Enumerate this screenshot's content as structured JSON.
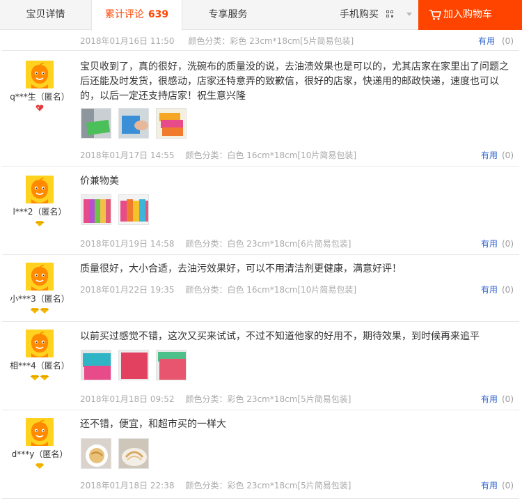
{
  "tabs": {
    "detail": "宝贝详情",
    "reviews": "累计评论",
    "reviews_count": "639",
    "service": "专享服务",
    "mobile": "手机购买",
    "cart": "加入购物车"
  },
  "accent_color": "#ff4400",
  "link_color": "#3366cc",
  "useful_label": "有用",
  "first_row": {
    "date": "2018年01月16日 11:50",
    "sku": "颜色分类：彩色  23cm*18cm[5片简易包装]",
    "useful_count": "(0)"
  },
  "reviews": [
    {
      "nick": "q***生（匿名）",
      "rank": "heart",
      "content": "宝贝收到了，真的很好，洗碗布的质量没的说，去油渍效果也是可以的，尤其店家在家里出了问题之后还能及时发货，很感动，店家还特意弄的致歉信，很好的店家，快递用的邮政快递，速度也可以的，以后一定还支持店家！祝生意兴隆",
      "photos": [
        "green-cloth-photo",
        "blue-cloth-photo",
        "pink-cloth-photo"
      ],
      "date": "2018年01月17日 14:55",
      "sku": "颜色分类：白色  16cm*18cm[10片简易包装]",
      "useful_count": "(0)"
    },
    {
      "nick": "l***2（匿名）",
      "rank": "diamond1",
      "content": "价兼物美",
      "photos": [
        "rolled-cloths-photo",
        "multicolor-cloths-photo"
      ],
      "date": "2018年01月19日 14:58",
      "sku": "颜色分类：白色  23cm*18cm[6片简易包装]",
      "useful_count": "(0)"
    },
    {
      "nick": "小***3（匿名）",
      "rank": "diamond2",
      "content": "质量很好，大小合适，去油污效果好，可以不用清洁剂更健康，满意好评！",
      "photos": [],
      "date": "2018年01月22日 19:35",
      "sku": "颜色分类：白色  16cm*18cm[10片简易包装]",
      "useful_count": "(0)"
    },
    {
      "nick": "相***4（匿名）",
      "rank": "diamond2",
      "content": "以前买过感觉不错，这次又买来试试，不过不知道他家的好用不，期待效果，到时候再来追平",
      "photos": [
        "teal-pink-cloth-photo",
        "red-cloth-photo",
        "pink-green-cloth-photo"
      ],
      "date": "2018年01月18日 09:52",
      "sku": "颜色分类：彩色  23cm*18cm[5片简易包装]",
      "useful_count": "(0)"
    },
    {
      "nick": "d***y（匿名）",
      "rank": "diamond1",
      "content": "还不错，便宜，和超市买的一样大",
      "photos": [
        "food-plate-photo",
        "food-bowl-photo"
      ],
      "date": "2018年01月18日 22:38",
      "sku": "颜色分类：彩色  23cm*18cm[5片简易包装]",
      "useful_count": "(0)"
    }
  ]
}
